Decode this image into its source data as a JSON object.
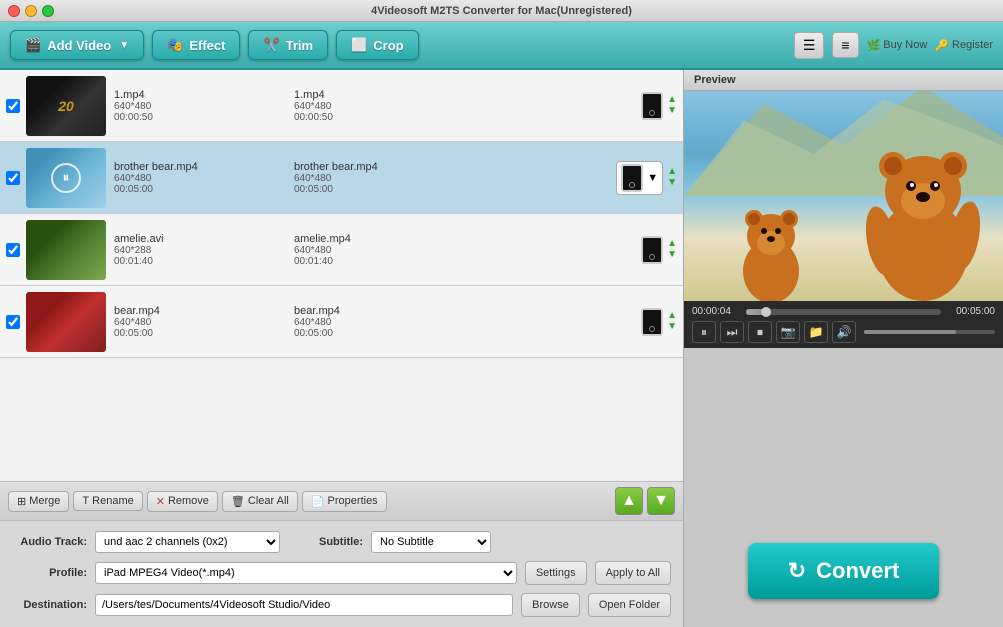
{
  "window": {
    "title": "4Videosoft M2TS Converter for Mac(Unregistered)"
  },
  "toolbar": {
    "add_video_label": "Add Video",
    "effect_label": "Effect",
    "trim_label": "Trim",
    "crop_label": "Crop",
    "buy_now_label": "Buy Now",
    "register_label": "Register"
  },
  "files": [
    {
      "id": 1,
      "checked": true,
      "name_src": "1.mp4",
      "res_src": "640*480",
      "dur_src": "00:00:50",
      "name_dst": "1.mp4",
      "res_dst": "640*480",
      "dur_dst": "00:00:50",
      "thumb_type": "fox",
      "selected": false
    },
    {
      "id": 2,
      "checked": true,
      "name_src": "brother bear.mp4",
      "res_src": "640*480",
      "dur_src": "00:05:00",
      "name_dst": "brother bear.mp4",
      "res_dst": "640*480",
      "dur_dst": "00:05:00",
      "thumb_type": "bear",
      "selected": true
    },
    {
      "id": 3,
      "checked": true,
      "name_src": "amelie.avi",
      "res_src": "640*288",
      "dur_src": "00:01:40",
      "name_dst": "amelie.mp4",
      "res_dst": "640*480",
      "dur_dst": "00:01:40",
      "thumb_type": "amelie",
      "selected": false
    },
    {
      "id": 4,
      "checked": true,
      "name_src": "bear.mp4",
      "res_src": "640*480",
      "dur_src": "00:05:00",
      "name_dst": "bear.mp4",
      "res_dst": "640*480",
      "dur_dst": "00:05:00",
      "thumb_type": "bear2",
      "selected": false
    }
  ],
  "bottom_toolbar": {
    "merge_label": "Merge",
    "rename_label": "Rename",
    "remove_label": "Remove",
    "clear_all_label": "Clear All",
    "properties_label": "Properties"
  },
  "settings": {
    "audio_track_label": "Audio Track:",
    "audio_track_value": "und aac 2 channels (0x2)",
    "subtitle_label": "Subtitle:",
    "subtitle_value": "No Subtitle",
    "profile_label": "Profile:",
    "profile_value": "iPad MPEG4 Video(*.mp4)",
    "settings_btn": "Settings",
    "apply_to_all_btn": "Apply to All",
    "destination_label": "Destination:",
    "destination_value": "/Users/tes/Documents/4Videosoft Studio/Video",
    "browse_btn": "Browse",
    "open_folder_btn": "Open Folder"
  },
  "preview": {
    "label": "Preview",
    "current_time": "00:00:04",
    "total_time": "00:05:00",
    "progress_pct": 10
  },
  "convert": {
    "label": "Convert"
  },
  "colors": {
    "toolbar_teal": "#3aabab",
    "selected_row": "#b8d8e8",
    "convert_teal": "#009999"
  }
}
